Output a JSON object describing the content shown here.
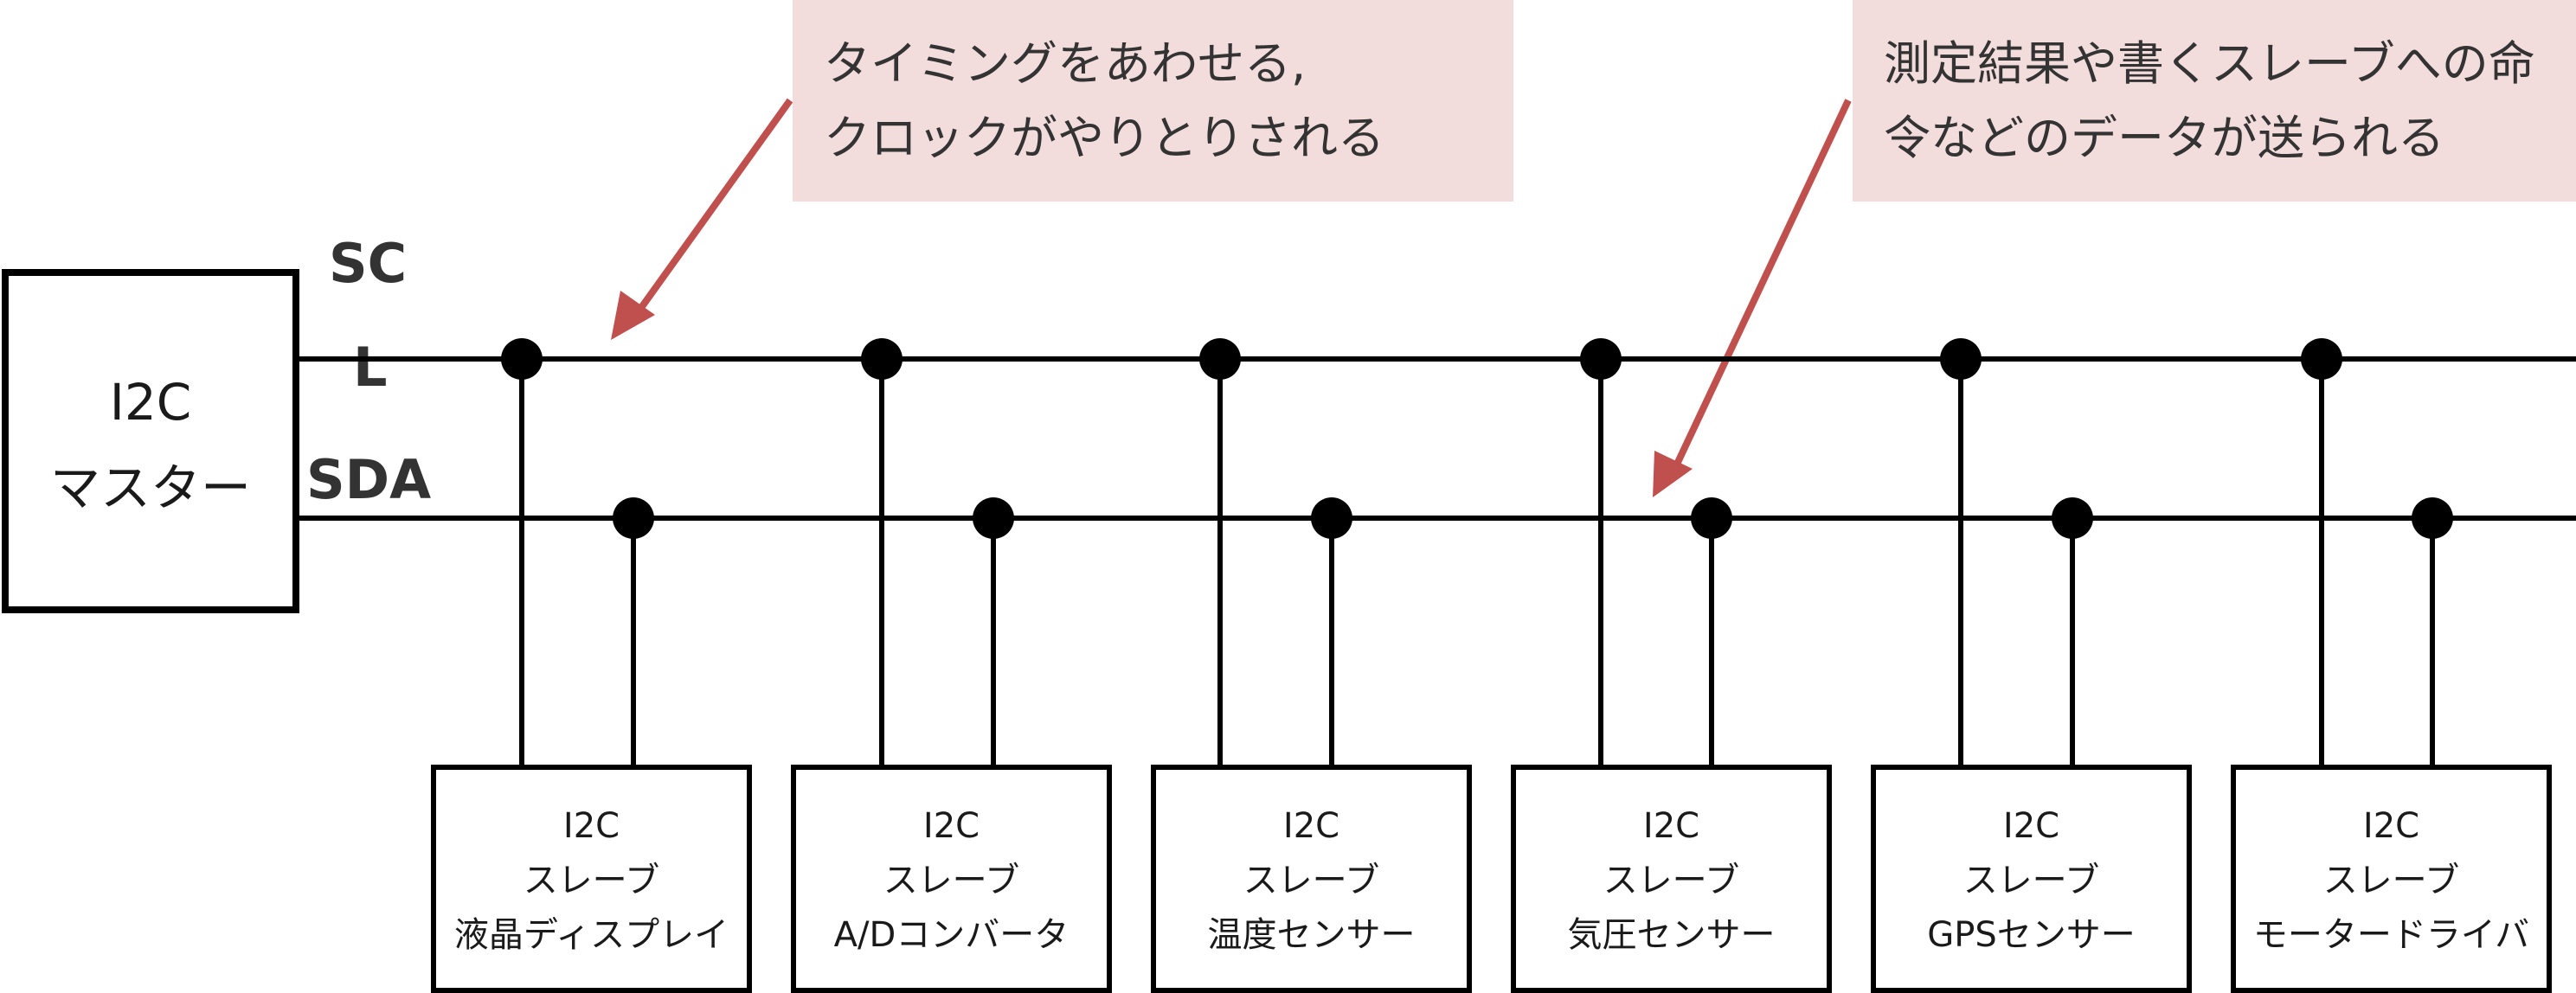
{
  "master": {
    "line1": "I2C",
    "line2": "マスター"
  },
  "bus_labels": {
    "scl_top": "SC",
    "scl_bottom": "L",
    "sda": "SDA"
  },
  "callouts": [
    {
      "lines": [
        "タイミングをあわせる,",
        "クロックがやりとりされる"
      ]
    },
    {
      "lines": [
        "測定結果や書くスレーブへの命",
        "令などのデータが送られる"
      ]
    }
  ],
  "slaves": [
    {
      "line1": "I2C",
      "line2": "スレーブ",
      "line3": "液晶ディスプレイ"
    },
    {
      "line1": "I2C",
      "line2": "スレーブ",
      "line3": "A/Dコンバータ"
    },
    {
      "line1": "I2C",
      "line2": "スレーブ",
      "line3": "温度センサー"
    },
    {
      "line1": "I2C",
      "line2": "スレーブ",
      "line3": "気圧センサー"
    },
    {
      "line1": "I2C",
      "line2": "スレーブ",
      "line3": "GPSセンサー"
    },
    {
      "line1": "I2C",
      "line2": "スレーブ",
      "line3": "モータードライバ"
    }
  ],
  "colors": {
    "line": "#000000",
    "callout_bg": "#f2dcdc",
    "arrow": "#c0504d",
    "text": "#333333"
  }
}
